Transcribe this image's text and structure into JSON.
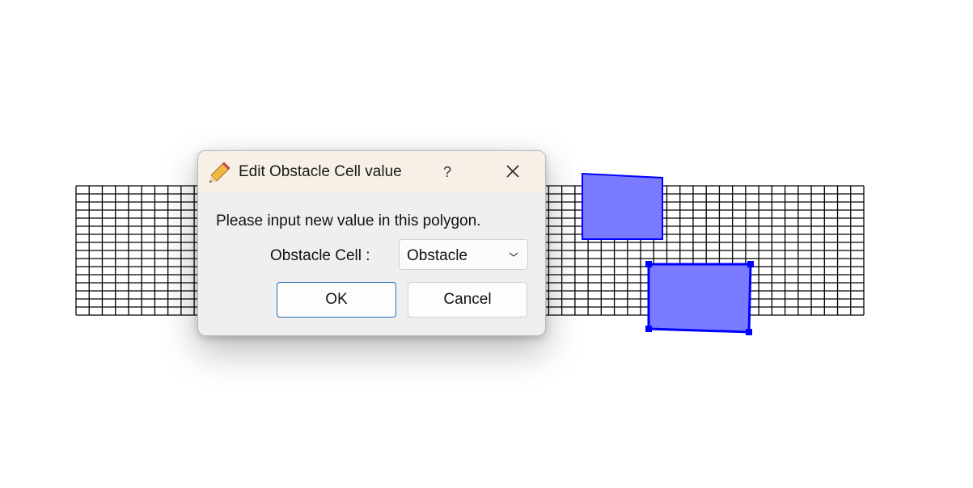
{
  "dialog": {
    "title": "Edit Obstacle Cell value",
    "help_label": "?",
    "message": "Please input new value in this polygon.",
    "field_label": "Obstacle Cell :",
    "field_value": "Obstacle",
    "ok_label": "OK",
    "cancel_label": "Cancel"
  },
  "colors": {
    "grid_line": "#000000",
    "polygon_fill": "#7b7bff",
    "polygon_stroke": "#0000ff",
    "titlebar": "#f7f0e6",
    "dialog_bg": "#efefef"
  },
  "icons": {
    "title_icon": "pencil-icon",
    "close_icon": "close-icon",
    "combo_arrow": "chevron-down-icon"
  }
}
